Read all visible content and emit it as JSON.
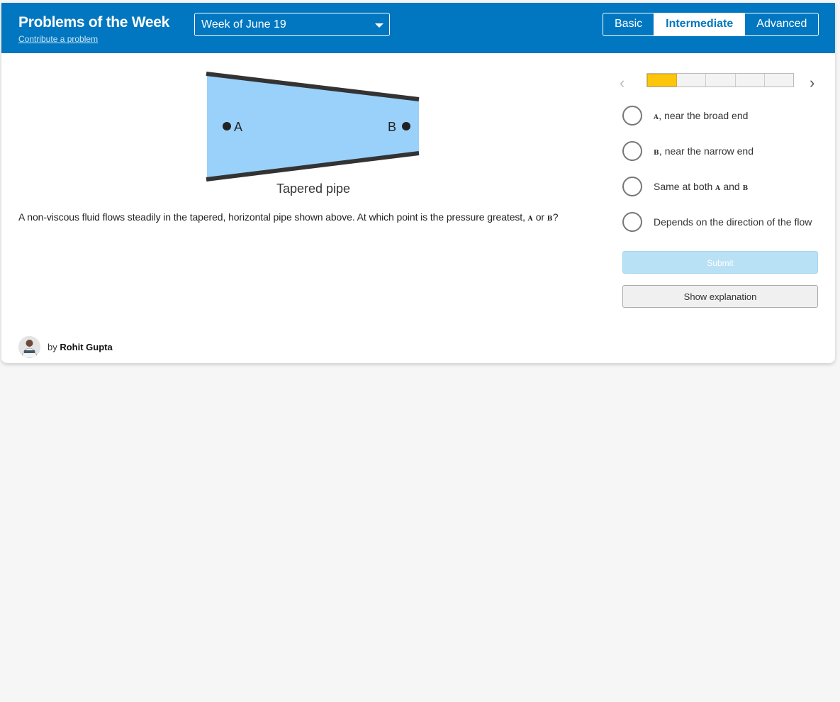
{
  "header": {
    "title": "Problems of the Week",
    "contribute_link": "Contribute a problem",
    "week_select": "Week of June 19",
    "levels": [
      {
        "label": "Basic",
        "active": false
      },
      {
        "label": "Intermediate",
        "active": true
      },
      {
        "label": "Advanced",
        "active": false
      }
    ]
  },
  "problem": {
    "diagram": {
      "caption": "Tapered pipe",
      "point_a": "A",
      "point_b": "B"
    },
    "question_before": "A non-viscous fluid flows steadily in the tapered, horizontal pipe shown above. At which point is the pressure greatest, ",
    "question_a": "A",
    "question_or": " or ",
    "question_b": "B",
    "question_end": "?"
  },
  "progress": {
    "total": 5,
    "current": 1
  },
  "choices": [
    {
      "mark": "A",
      "text": ", near the broad end"
    },
    {
      "mark": "B",
      "text": ", near the narrow end"
    },
    {
      "prefix": "Same at both ",
      "mark": "A",
      "mid": " and ",
      "mark2": "B"
    },
    {
      "text": "Depends on the direction of the flow"
    }
  ],
  "buttons": {
    "submit": "Submit",
    "show_explanation": "Show explanation"
  },
  "author": {
    "by": "by ",
    "name": "Rohit Gupta"
  },
  "colors": {
    "header_bg": "#0077c0",
    "fluid": "#99d1fb",
    "progress_current": "#fdc60a",
    "submit_disabled": "#b9e1f6"
  }
}
